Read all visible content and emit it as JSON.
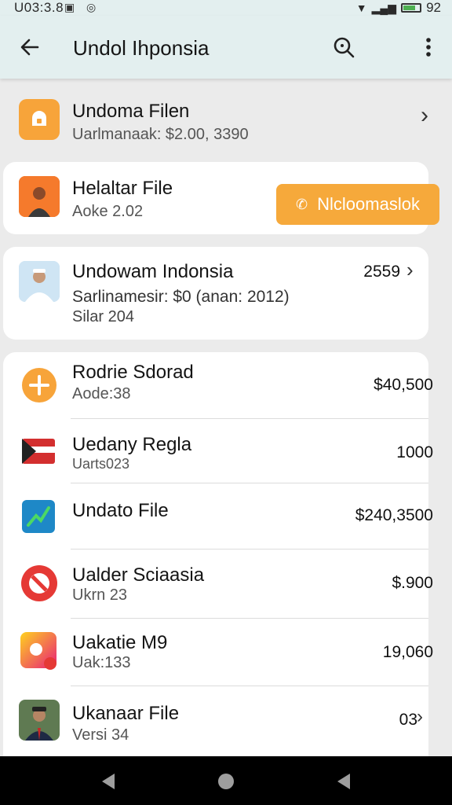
{
  "status_bar": {
    "time": "U03:3.8",
    "right_text": "92"
  },
  "app_bar": {
    "title": "Undol Ihponsia"
  },
  "card1": {
    "title": "Undoma Filen",
    "subtitle": "Uarlmanaak: $2.00, 3390",
    "chevron": "›"
  },
  "card2": {
    "title": "Helaltar File",
    "subtitle": "Aoke 2.02",
    "button_label": "Nlcloomaslok"
  },
  "card3": {
    "title": "Undowam Indonsia",
    "subtitle": "Sarlinamesir: $0 (anan: 2012)",
    "subtitle2": "Silar 204",
    "value": "2559"
  },
  "list": {
    "items": [
      {
        "title": "Rodrie Sdorad",
        "subtitle": "Aode:38",
        "value": "$40,500"
      },
      {
        "title": "Uedany Regla",
        "subtitle": "Uarts023",
        "value": "1000"
      },
      {
        "title": "Undato File",
        "subtitle": "",
        "value": "$240,3500"
      },
      {
        "title": "Ualder Sciaasia",
        "subtitle": "Ukrn 23",
        "value": "$.900"
      },
      {
        "title": "Uakatie M9",
        "subtitle": "Uak:133",
        "value": "19,060"
      },
      {
        "title": "Ukanaar File",
        "subtitle": "Versi 34",
        "value": "03"
      }
    ]
  },
  "colors": {
    "accent_orange": "#f6a93b",
    "appbar": "#e3efef",
    "background": "#ebebeb"
  },
  "icons": [
    "back-arrow-icon",
    "search-icon",
    "more-vert-icon",
    "chevron-right-icon",
    "phone-icon"
  ]
}
